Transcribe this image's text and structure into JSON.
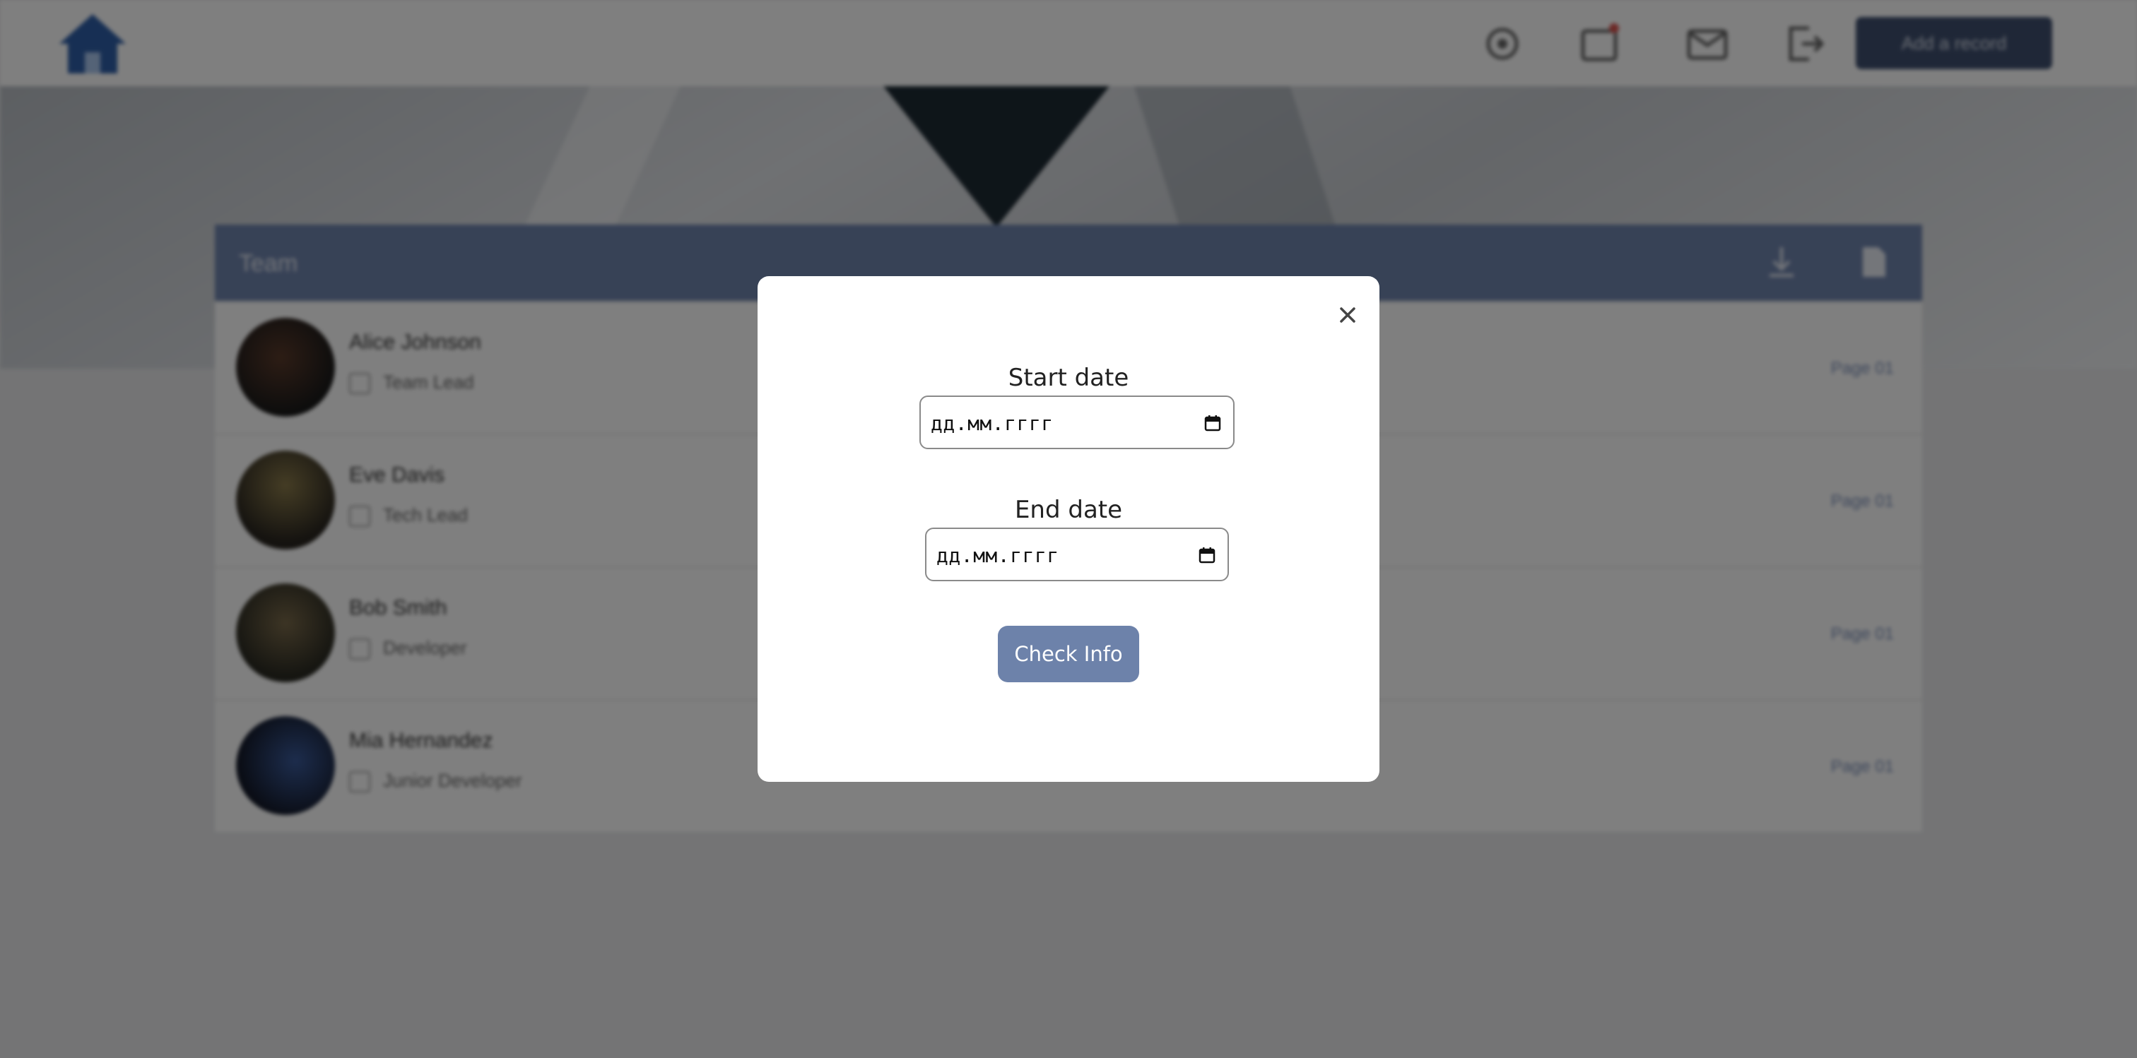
{
  "header": {
    "action_button_label": "Add a record"
  },
  "panel": {
    "title": "Team",
    "rows": [
      {
        "name": "Alice Johnson",
        "role": "Team Lead",
        "link": "Page 01"
      },
      {
        "name": "Eve Davis",
        "role": "Tech Lead",
        "link": "Page 01"
      },
      {
        "name": "Bob Smith",
        "role": "Developer",
        "link": "Page 01"
      },
      {
        "name": "Mia Hernandez",
        "role": "Junior Developer",
        "link": "Page 01"
      }
    ]
  },
  "modal": {
    "start_label": "Start date",
    "start_value": "дд.мм.гггг",
    "end_label": "End date",
    "end_value": "дд.мм.гггг",
    "submit_label": "Check Info",
    "close_icon": "close-icon"
  },
  "colors": {
    "accent": "#6d82aa",
    "header_bar": "#3f4f6f",
    "overlay": "rgba(0,0,0,0.5)"
  }
}
